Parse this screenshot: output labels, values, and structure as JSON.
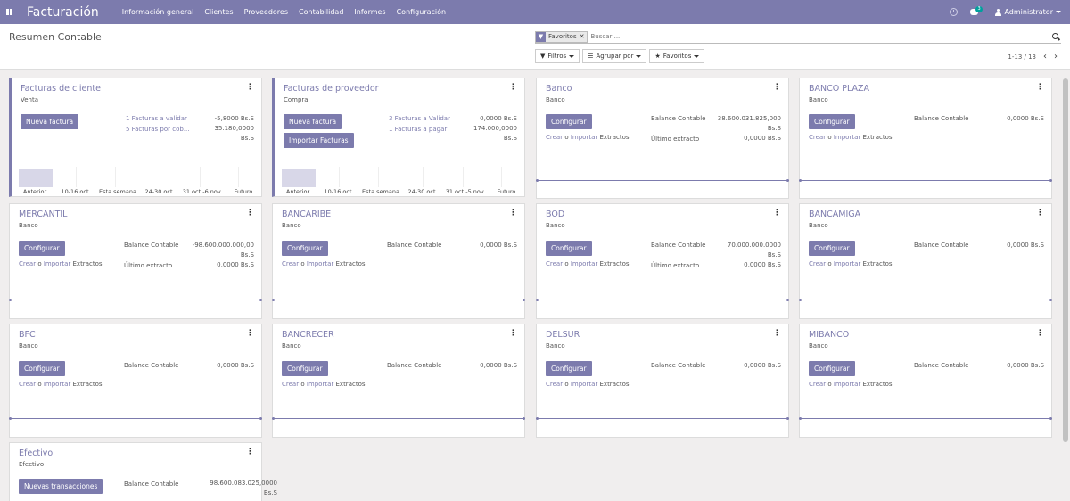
{
  "navbar": {
    "brand": "Facturación",
    "menu": [
      "Información general",
      "Clientes",
      "Proveedores",
      "Contabilidad",
      "Informes",
      "Configuración"
    ],
    "chat_count": "3",
    "user": "Administrator"
  },
  "control_panel": {
    "title": "Resumen Contable",
    "facet_value": "Favoritos",
    "search_placeholder": "Buscar ...",
    "filters_label": "Filtros",
    "groupby_label": "Agrupar por",
    "favorites_label": "Favoritos",
    "pager": "1-13 / 13"
  },
  "sale_journal": {
    "name": "Facturas de cliente",
    "type": "Venta",
    "button": "Nueva factura",
    "line1_label": "1 Facturas a validar",
    "line1_amount": "-5,8000 Bs.S",
    "line2_label": "5 Facturas por cob...",
    "line2_amount": "35.180,0000",
    "line2_unit": "Bs.S",
    "bars": [
      "Anterior",
      "10-16 oct.",
      "Esta semana",
      "24-30 oct.",
      "31 oct.-6 nov.",
      "Futuro"
    ]
  },
  "purchase_journal": {
    "name": "Facturas de proveedor",
    "type": "Compra",
    "button": "Nueva factura",
    "button2": "Importar Facturas",
    "line1_label": "3 Facturas a Validar",
    "line1_amount": "0,0000 Bs.S",
    "line2_label": "1 Facturas a pagar",
    "line2_amount": "174.000,0000",
    "line2_unit": "Bs.S",
    "bars": [
      "Anterior",
      "10-16 oct.",
      "Esta semana",
      "24-30 oct.",
      "31 oct.-5 nov.",
      "Futuro"
    ]
  },
  "labels": {
    "configure": "Configurar",
    "balance": "Balance Contable",
    "last_statement": "Último extracto",
    "create": "Crear",
    "or": "o",
    "import": "Importar",
    "statements": "Extractos",
    "new_transactions": "Nuevas transacciones"
  },
  "banks": [
    {
      "name": "Banco",
      "type": "Banco",
      "balance": "38.600.031.825,000",
      "balance_unit": "Bs.S",
      "last": "0,0000 Bs.S"
    },
    {
      "name": "BANCO PLAZA",
      "type": "Banco",
      "balance": "0,0000 Bs.S"
    },
    {
      "name": "MERCANTIL",
      "type": "Banco",
      "balance": "-98.600.000.000,00",
      "balance_unit": "Bs.S",
      "last": "0,0000 Bs.S"
    },
    {
      "name": "BANCARIBE",
      "type": "Banco",
      "balance": "0,0000 Bs.S"
    },
    {
      "name": "BOD",
      "type": "Banco",
      "balance": "70.000.000.0000",
      "balance_unit": "Bs.S",
      "last": "0,0000 Bs.S"
    },
    {
      "name": "BANCAMIGA",
      "type": "Banco",
      "balance": "0,0000 Bs.S"
    },
    {
      "name": "BFC",
      "type": "Banco",
      "balance": "0,0000 Bs.S"
    },
    {
      "name": "BANCRECER",
      "type": "Banco",
      "balance": "0,0000 Bs.S"
    },
    {
      "name": "DELSUR",
      "type": "Banco",
      "balance": "0,0000 Bs.S"
    },
    {
      "name": "MIBANCO",
      "type": "Banco",
      "balance": "0,0000 Bs.S"
    }
  ],
  "cash": {
    "name": "Efectivo",
    "type": "Efectivo",
    "balance": "98.600.083.025,0000",
    "balance_unit": "Bs.S"
  },
  "colors": {
    "brand": "#7c7bad"
  }
}
